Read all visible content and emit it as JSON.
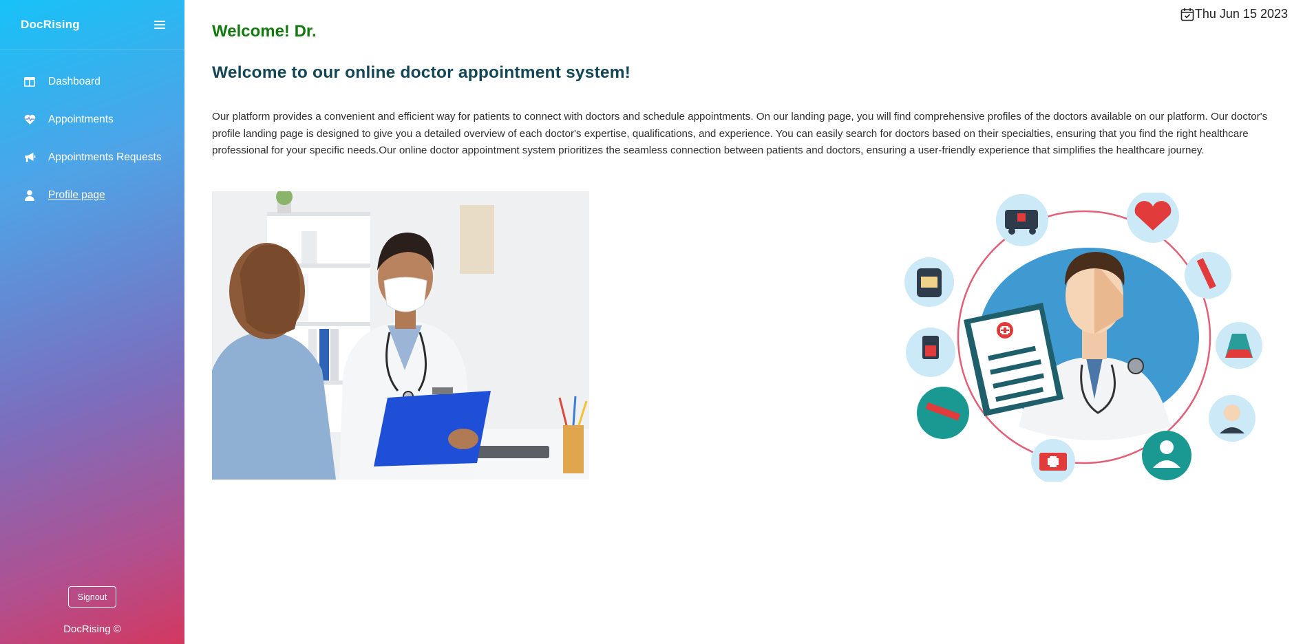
{
  "app": {
    "brand": "DocRising"
  },
  "sidebar": {
    "items": [
      {
        "label": "Dashboard",
        "icon": "dashboard-icon"
      },
      {
        "label": "Appointments",
        "icon": "heart-pulse-icon"
      },
      {
        "label": "Appointments Requests",
        "icon": "megaphone-icon"
      },
      {
        "label": "Profile page",
        "icon": "user-icon"
      }
    ],
    "signout_label": "Signout",
    "footer": "DocRising ©"
  },
  "header": {
    "date": "Thu Jun 15 2023"
  },
  "main": {
    "welcome": "Welcome! Dr.",
    "subtitle": "Welcome to our online doctor appointment system!",
    "intro": "Our platform provides a convenient and efficient way for patients to connect with doctors and schedule appointments. On our landing page, you will find comprehensive profiles of the doctors available on our platform. Our doctor's profile landing page is designed to give you a detailed overview of each doctor's expertise, qualifications, and experience. You can easily search for doctors based on their specialties, ensuring that you find the right healthcare professional for your specific needs.Our online doctor appointment system prioritizes the seamless connection between patients and doctors, ensuring a user-friendly experience that simplifies the healthcare journey."
  },
  "colors": {
    "sidebar_gradient": [
      "#17c2f8",
      "#7a6fbf",
      "#d3385f"
    ],
    "welcome": "#13790f",
    "subtitle": "#144756"
  }
}
